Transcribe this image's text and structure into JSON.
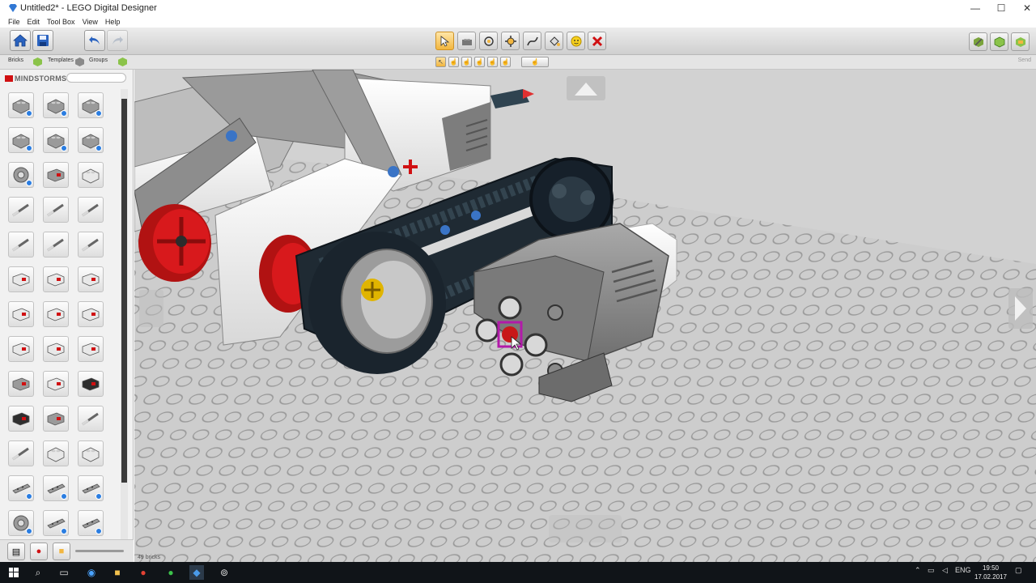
{
  "window": {
    "title": "Untitled2* - LEGO Digital Designer",
    "minimize": "—",
    "maximize": "☐",
    "close": "✕"
  },
  "menu": [
    "File",
    "Edit",
    "Tool Box",
    "View",
    "Help"
  ],
  "palette_tabs": {
    "bricks": "Bricks",
    "templates": "Templates",
    "groups": "Groups",
    "send": "Send"
  },
  "palette": {
    "brand": "MINDSTORMS",
    "search_placeholder": ""
  },
  "status": {
    "brick_count": "49 bricks"
  },
  "taskbar": {
    "language": "ENG",
    "time": "19:50",
    "date": "17.02.2017"
  },
  "colors": {
    "accent_active_tool": "#f2b640",
    "lego_red": "#d01012",
    "brick_gray": "#8c8c8c",
    "track_dark": "#1f2a33",
    "baseplate": "#c9c9c9"
  }
}
